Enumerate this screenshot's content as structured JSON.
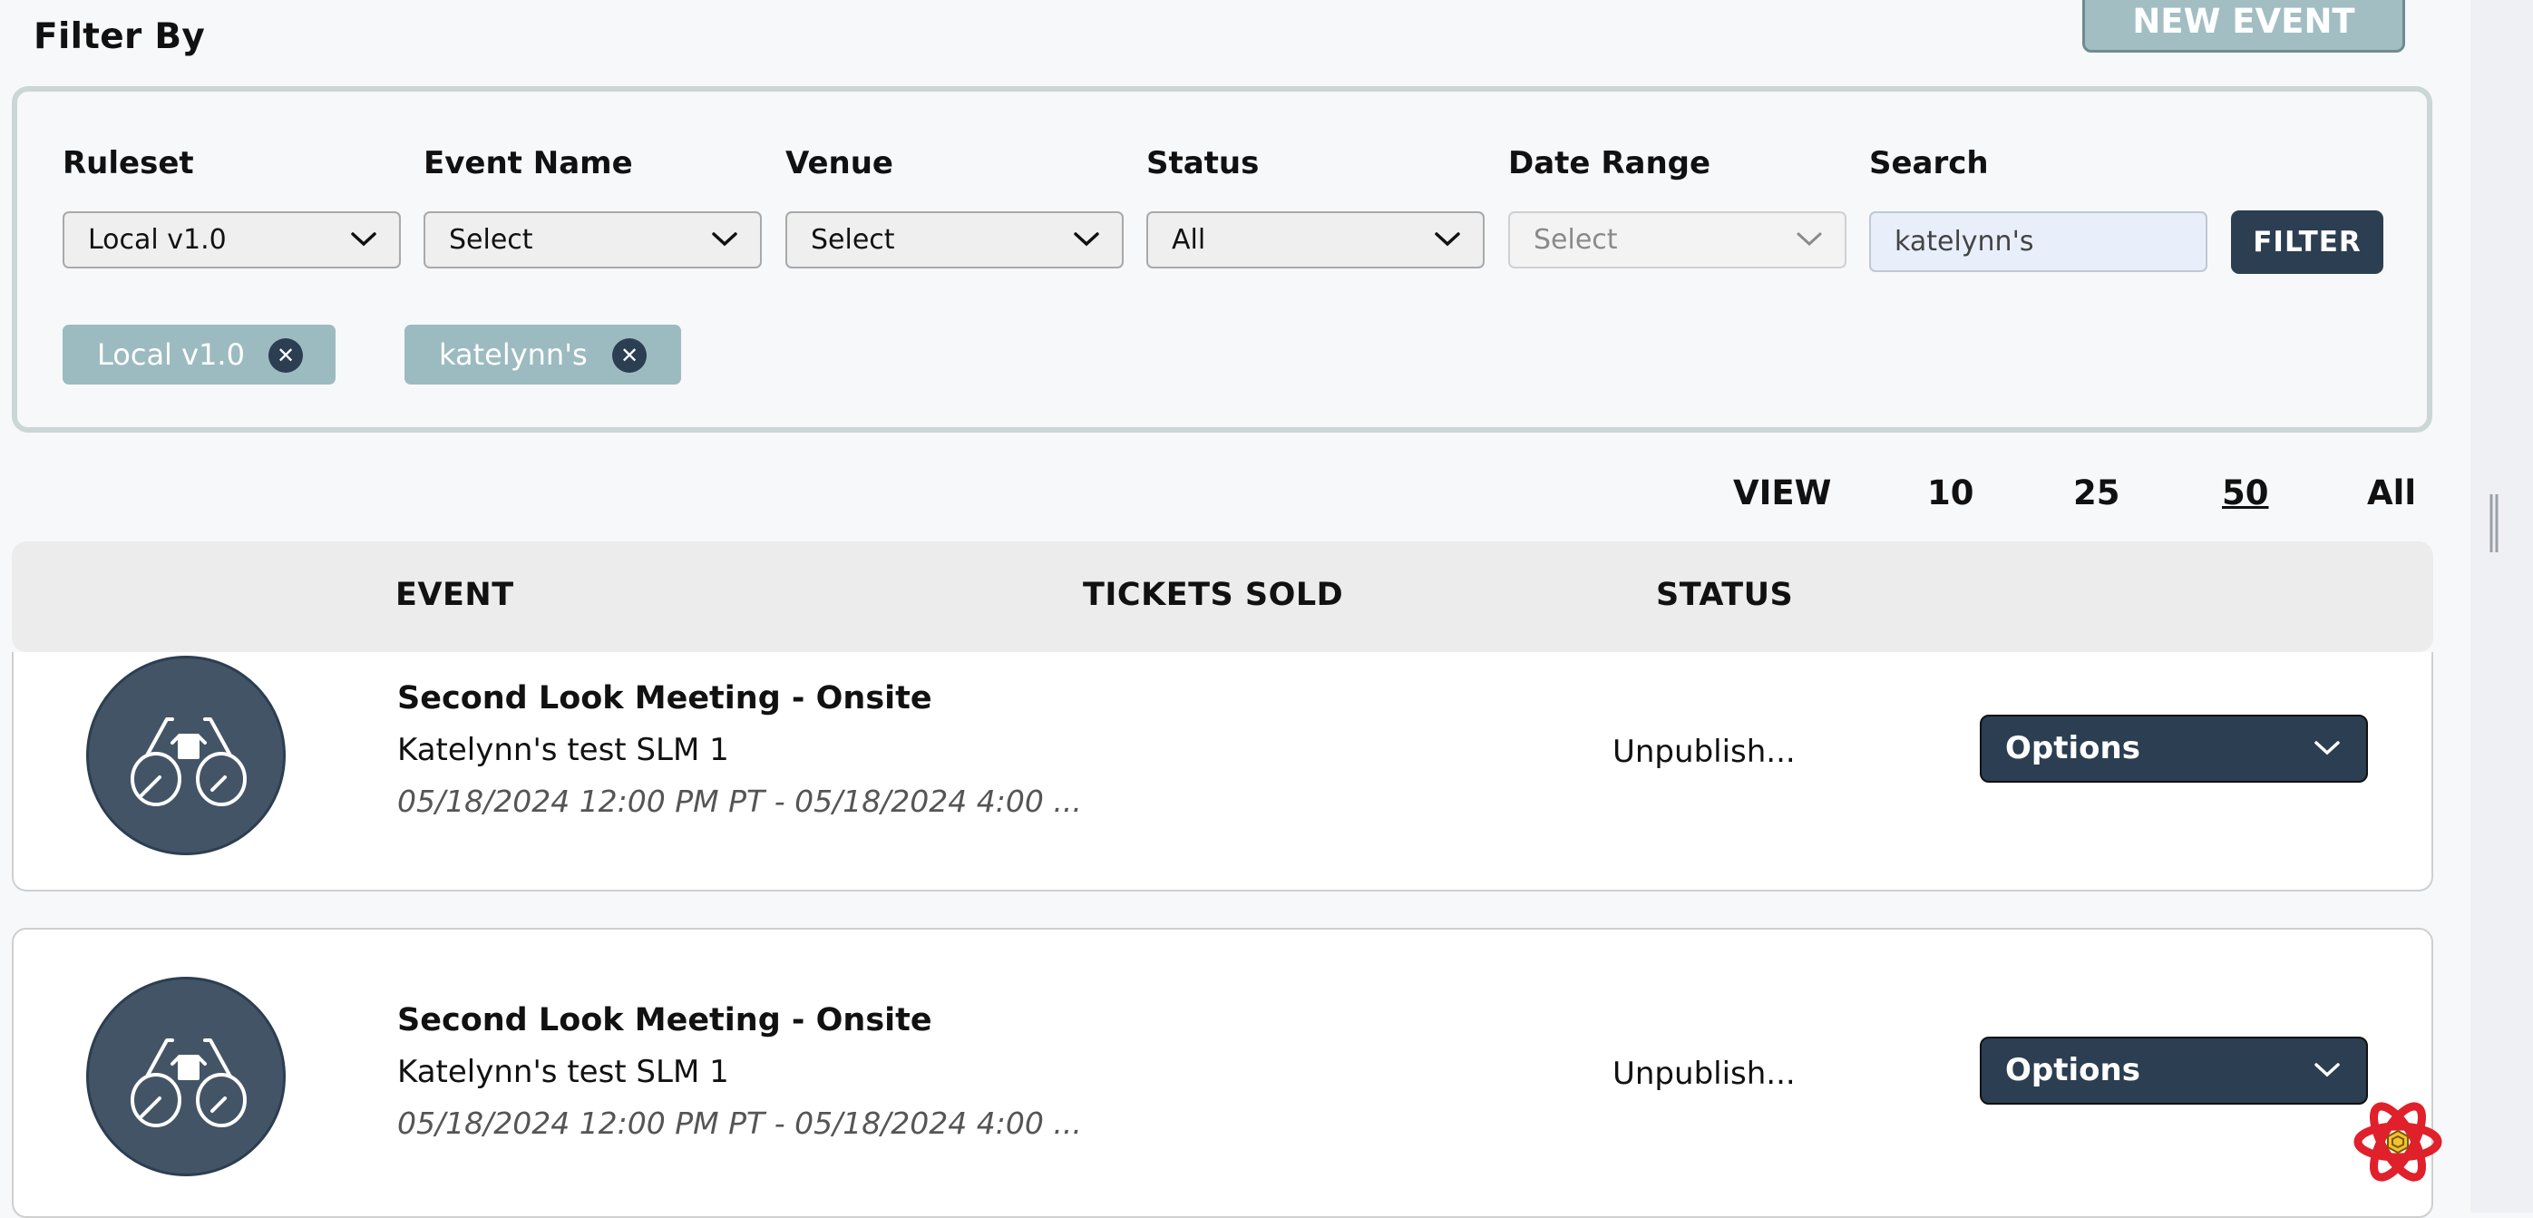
{
  "header": {
    "filter_title": "Filter By",
    "new_event_label": "NEW EVENT"
  },
  "filters": {
    "ruleset": {
      "label": "Ruleset",
      "value": "Local v1.0"
    },
    "event_name": {
      "label": "Event Name",
      "value": "Select"
    },
    "venue": {
      "label": "Venue",
      "value": "Select"
    },
    "status": {
      "label": "Status",
      "value": "All"
    },
    "date_range": {
      "label": "Date Range",
      "value": "Select"
    },
    "search": {
      "label": "Search",
      "value": "katelynn's"
    },
    "filter_button": "FILTER",
    "chips": [
      "Local v1.0",
      "katelynn's"
    ],
    "chip_remove_glyph": "✕"
  },
  "view": {
    "label": "VIEW",
    "options": [
      "10",
      "25",
      "50",
      "All"
    ],
    "selected": "50"
  },
  "table": {
    "columns": [
      "EVENT",
      "TICKETS SOLD",
      "STATUS"
    ],
    "rows": [
      {
        "title": "Second Look Meeting - Onsite",
        "subtitle": "Katelynn's test SLM 1",
        "date": "05/18/2024 12:00 PM PT - 05/18/2024 4:00 ...",
        "status": "Unpublish...",
        "options_label": "Options"
      },
      {
        "title": "Second Look Meeting - Onsite",
        "subtitle": "Katelynn's test SLM 1",
        "date": "05/18/2024 12:00 PM PT - 05/18/2024 4:00 ...",
        "status": "Unpublish...",
        "options_label": "Options"
      }
    ]
  },
  "icons": {
    "event_avatar": "binoculars-icon",
    "dropdown": "chevron-down-icon",
    "chip_remove": "close-icon",
    "dev_tool": "react-icon"
  },
  "colors": {
    "navy": "#2c3e51",
    "chip": "#9cbbc0",
    "new_event": "#a2bec2",
    "panel_border": "#cbd7d6",
    "react_red": "#e0202a",
    "react_gold": "#f2c230"
  }
}
